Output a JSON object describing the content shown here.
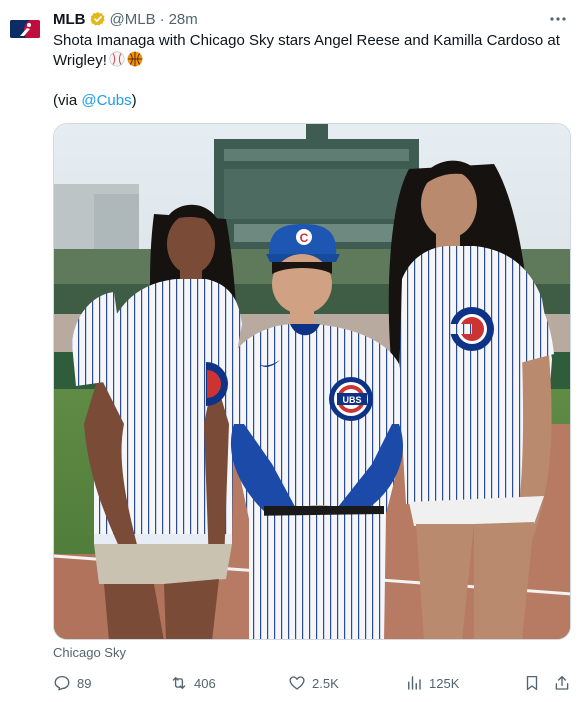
{
  "tweet": {
    "author_name": "MLB",
    "handle": "@MLB",
    "separator": "·",
    "time": "28m",
    "text_line1": "Shota Imanaga with Chicago Sky stars Angel Reese and Kamilla Cardoso at",
    "text_line2": "Wrigley!",
    "via_prefix": "(via ",
    "via_link": "@Cubs",
    "via_suffix": ")",
    "media_caption": "Chicago Sky"
  },
  "icons": {
    "avatar": "mlb-logo-icon",
    "badge": "verified-gold-badge-icon",
    "more": "more-dots-icon",
    "emoji1": "baseball-emoji",
    "emoji2": "basketball-emoji"
  },
  "actions": {
    "reply_count": "89",
    "retweet_count": "406",
    "like_count": "2.5K",
    "views_count": "125K"
  },
  "colors": {
    "accent": "#1d9bf0",
    "secondary_text": "#536471",
    "badge_gold": "#e2b719",
    "cubs_blue": "#0e3386",
    "cubs_red": "#cc3433"
  }
}
